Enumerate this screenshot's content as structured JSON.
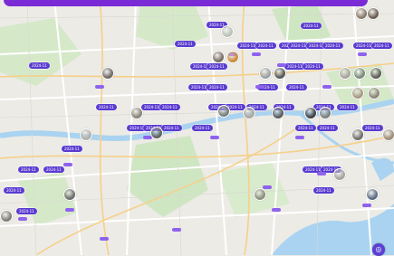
{
  "map": {
    "marker_label": "2024-11",
    "locate_icon": "locate-me-icon",
    "marker_count": 42,
    "photo_count": 26
  },
  "colors": {
    "accent": "#7a2bd6",
    "pill": "#5a3bd0",
    "tag": "#8f62ee",
    "water": "#a9d3f0",
    "park": "#cfe8c4",
    "road": "#ffffff",
    "arterial": "#f6d08a",
    "land": "#ecebe6"
  }
}
